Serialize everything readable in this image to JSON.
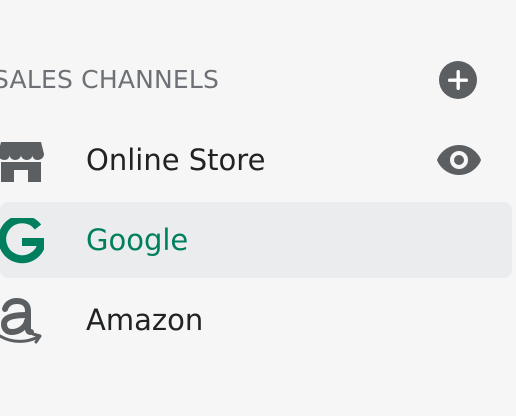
{
  "sidebar": {
    "section_title": "SALES CHANNELS",
    "add_icon": "plus-circle-icon",
    "channels": [
      {
        "label": "Online Store",
        "icon": "storefront-icon",
        "action_icon": "eye-icon",
        "active": false
      },
      {
        "label": "Google",
        "icon": "google-icon",
        "active": true
      },
      {
        "label": "Amazon",
        "icon": "amazon-icon",
        "active": false
      }
    ]
  },
  "colors": {
    "background": "#f6f6f7",
    "active_background": "#ebeced",
    "text": "#202223",
    "muted_text": "#6d7175",
    "active_text": "#007f5f",
    "icon": "#5c5f62"
  }
}
